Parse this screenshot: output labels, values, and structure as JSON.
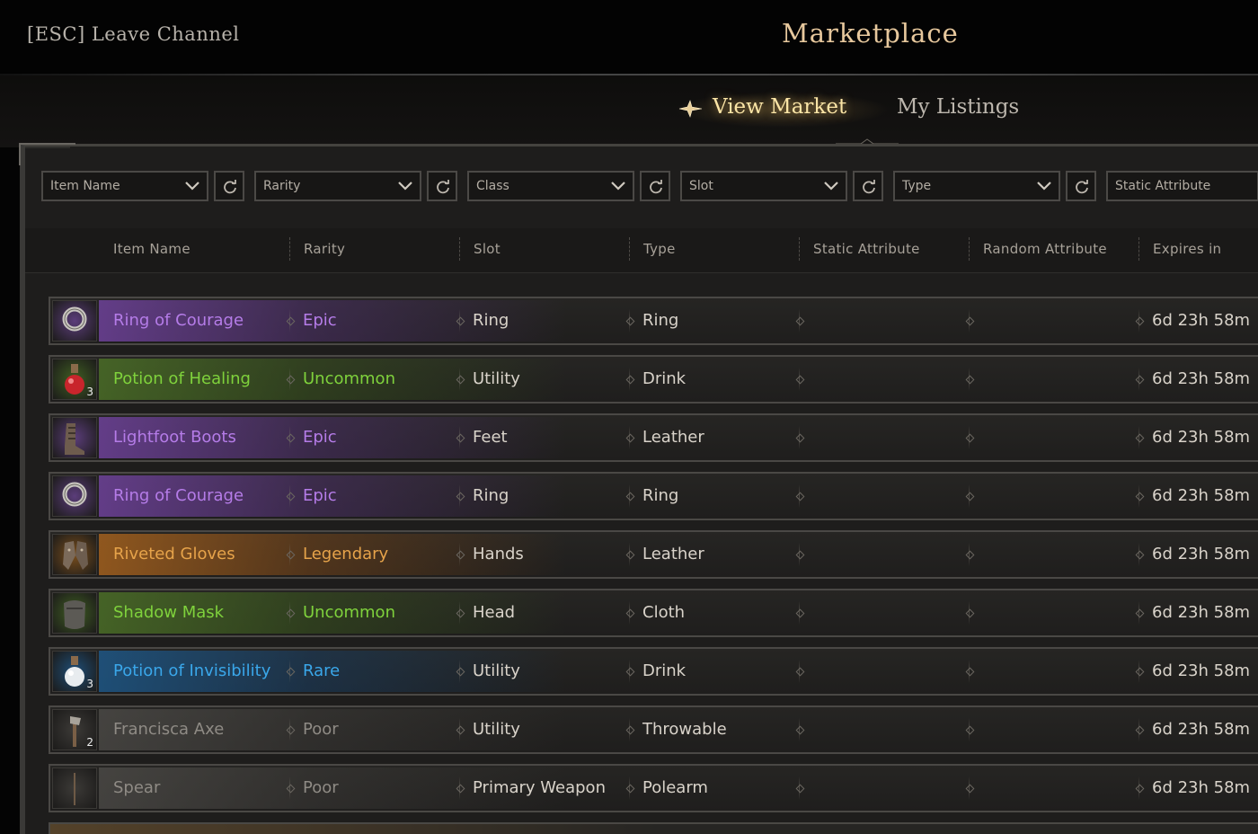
{
  "header": {
    "leave_label": "[ESC] Leave Channel",
    "title": "Marketplace"
  },
  "tabs": [
    {
      "label": "View Market",
      "active": true
    },
    {
      "label": "My Listings",
      "active": false
    }
  ],
  "filters": [
    {
      "label": "Item Name"
    },
    {
      "label": "Rarity"
    },
    {
      "label": "Class"
    },
    {
      "label": "Slot"
    },
    {
      "label": "Type"
    },
    {
      "label": "Static Attribute"
    }
  ],
  "columns": [
    "Item Name",
    "Rarity",
    "Slot",
    "Type",
    "Static Attribute",
    "Random Attribute",
    "Expires in"
  ],
  "rarity_colors": {
    "Epic": "#b57ce8",
    "Uncommon": "#7fd23c",
    "Legendary": "#e6a34a",
    "Rare": "#3aa7ea",
    "Poor": "#8f8b85"
  },
  "rows": [
    {
      "name": "Ring of Courage",
      "rarity": "Epic",
      "slot": "Ring",
      "type": "Ring",
      "static_attr": "",
      "random_attr": "",
      "expires": "6d 23h 58m",
      "icon": "ring-icon",
      "qty": ""
    },
    {
      "name": "Potion of Healing",
      "rarity": "Uncommon",
      "slot": "Utility",
      "type": "Drink",
      "static_attr": "",
      "random_attr": "",
      "expires": "6d 23h 58m",
      "icon": "red-potion-icon",
      "qty": "3"
    },
    {
      "name": "Lightfoot Boots",
      "rarity": "Epic",
      "slot": "Feet",
      "type": "Leather",
      "static_attr": "",
      "random_attr": "",
      "expires": "6d 23h 58m",
      "icon": "boots-icon",
      "qty": ""
    },
    {
      "name": "Ring of Courage",
      "rarity": "Epic",
      "slot": "Ring",
      "type": "Ring",
      "static_attr": "",
      "random_attr": "",
      "expires": "6d 23h 58m",
      "icon": "ring-icon",
      "qty": ""
    },
    {
      "name": "Riveted Gloves",
      "rarity": "Legendary",
      "slot": "Hands",
      "type": "Leather",
      "static_attr": "",
      "random_attr": "",
      "expires": "6d 23h 58m",
      "icon": "gloves-icon",
      "qty": ""
    },
    {
      "name": "Shadow Mask",
      "rarity": "Uncommon",
      "slot": "Head",
      "type": "Cloth",
      "static_attr": "",
      "random_attr": "",
      "expires": "6d 23h 58m",
      "icon": "mask-icon",
      "qty": ""
    },
    {
      "name": "Potion of Invisibility",
      "rarity": "Rare",
      "slot": "Utility",
      "type": "Drink",
      "static_attr": "",
      "random_attr": "",
      "expires": "6d 23h 58m",
      "icon": "white-potion-icon",
      "qty": "3"
    },
    {
      "name": "Francisca Axe",
      "rarity": "Poor",
      "slot": "Utility",
      "type": "Throwable",
      "static_attr": "",
      "random_attr": "",
      "expires": "6d 23h 58m",
      "icon": "axe-icon",
      "qty": "2"
    },
    {
      "name": "Spear",
      "rarity": "Poor",
      "slot": "Primary Weapon",
      "type": "Polearm",
      "static_attr": "",
      "random_attr": "",
      "expires": "6d 23h 58m",
      "icon": "spear-icon",
      "qty": ""
    }
  ]
}
